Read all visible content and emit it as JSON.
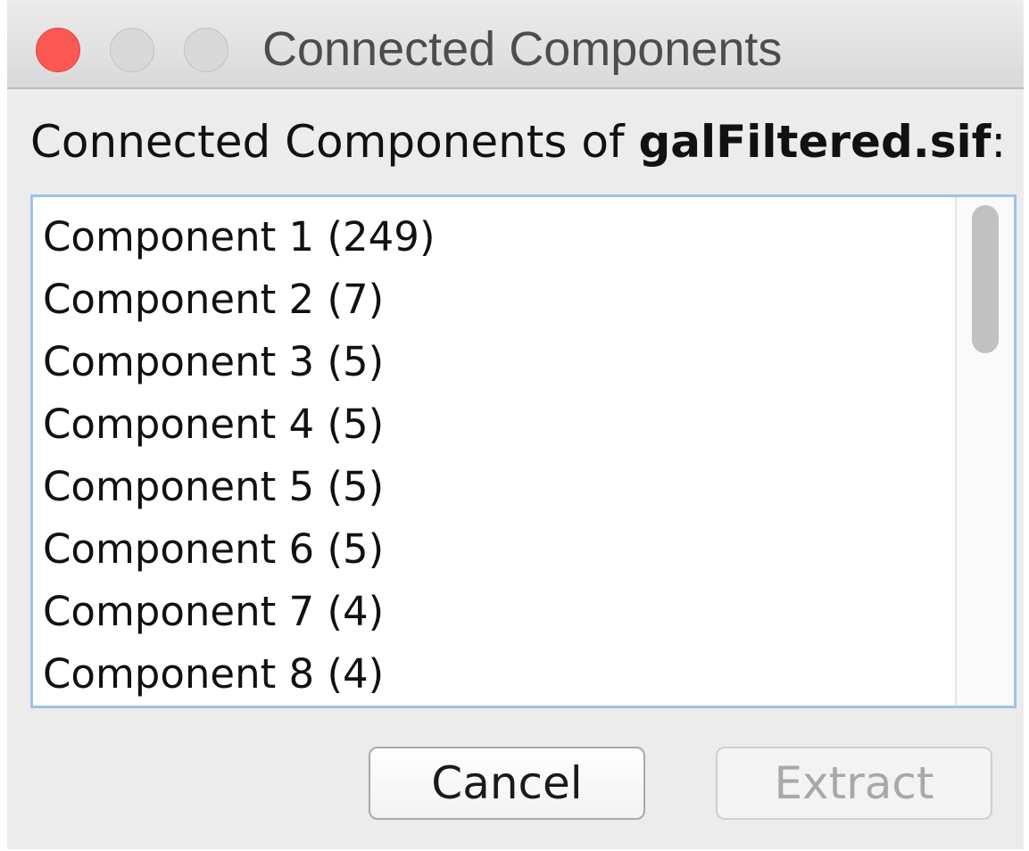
{
  "window": {
    "title": "Connected Components"
  },
  "heading": {
    "prefix": "Connected Components of ",
    "network_name": "galFiltered.sif",
    "suffix": ":"
  },
  "components": [
    "Component 1 (249)",
    "Component 2 (7)",
    "Component 3 (5)",
    "Component 4 (5)",
    "Component 5 (5)",
    "Component 6 (5)",
    "Component 7 (4)",
    "Component 8 (4)"
  ],
  "buttons": {
    "cancel_label": "Cancel",
    "extract_label": "Extract",
    "extract_enabled": false
  },
  "colors": {
    "close_button": "#fc5753",
    "list_focus_border": "#9cc3ea",
    "disabled_text": "#a8a8a8"
  },
  "icons": {
    "close": "close-icon",
    "minimize": "minimize-icon",
    "maximize": "zoom-icon"
  }
}
